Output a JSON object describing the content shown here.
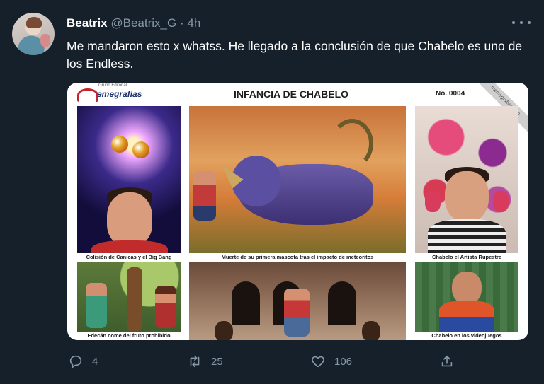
{
  "tweet": {
    "display_name": "Beatrix",
    "handle": "@Beatrix_G",
    "separator": "·",
    "time": "4h",
    "text": "Me mandaron esto x whatss. He llegado a la conclusión de que Chabelo es uno de los Endless."
  },
  "card": {
    "logo_small": "Grupo Editorial",
    "logo_text": "emegrafías",
    "title": "INFANCIA DE CHABELO",
    "number": "No.  0004",
    "banner": "memegrafias.com",
    "captions": [
      "Colisión de Canicas y el Big Bang",
      "Muerte de su primera mascota tras el impacto de meteoritos",
      "Chabelo el Artista Rupestre",
      "Edecán come del fruto prohibido",
      "",
      "Chabelo en los videojuegos"
    ]
  },
  "actions": {
    "reply_count": "4",
    "retweet_count": "25",
    "like_count": "106"
  },
  "icons": {
    "reply": "reply-icon",
    "retweet": "retweet-icon",
    "like": "heart-icon",
    "share": "share-icon",
    "more": "more-icon"
  },
  "colors": {
    "background": "#15202b",
    "secondary_text": "#8899a6",
    "logo_red": "#c0262d",
    "logo_blue": "#1b2f6b"
  }
}
